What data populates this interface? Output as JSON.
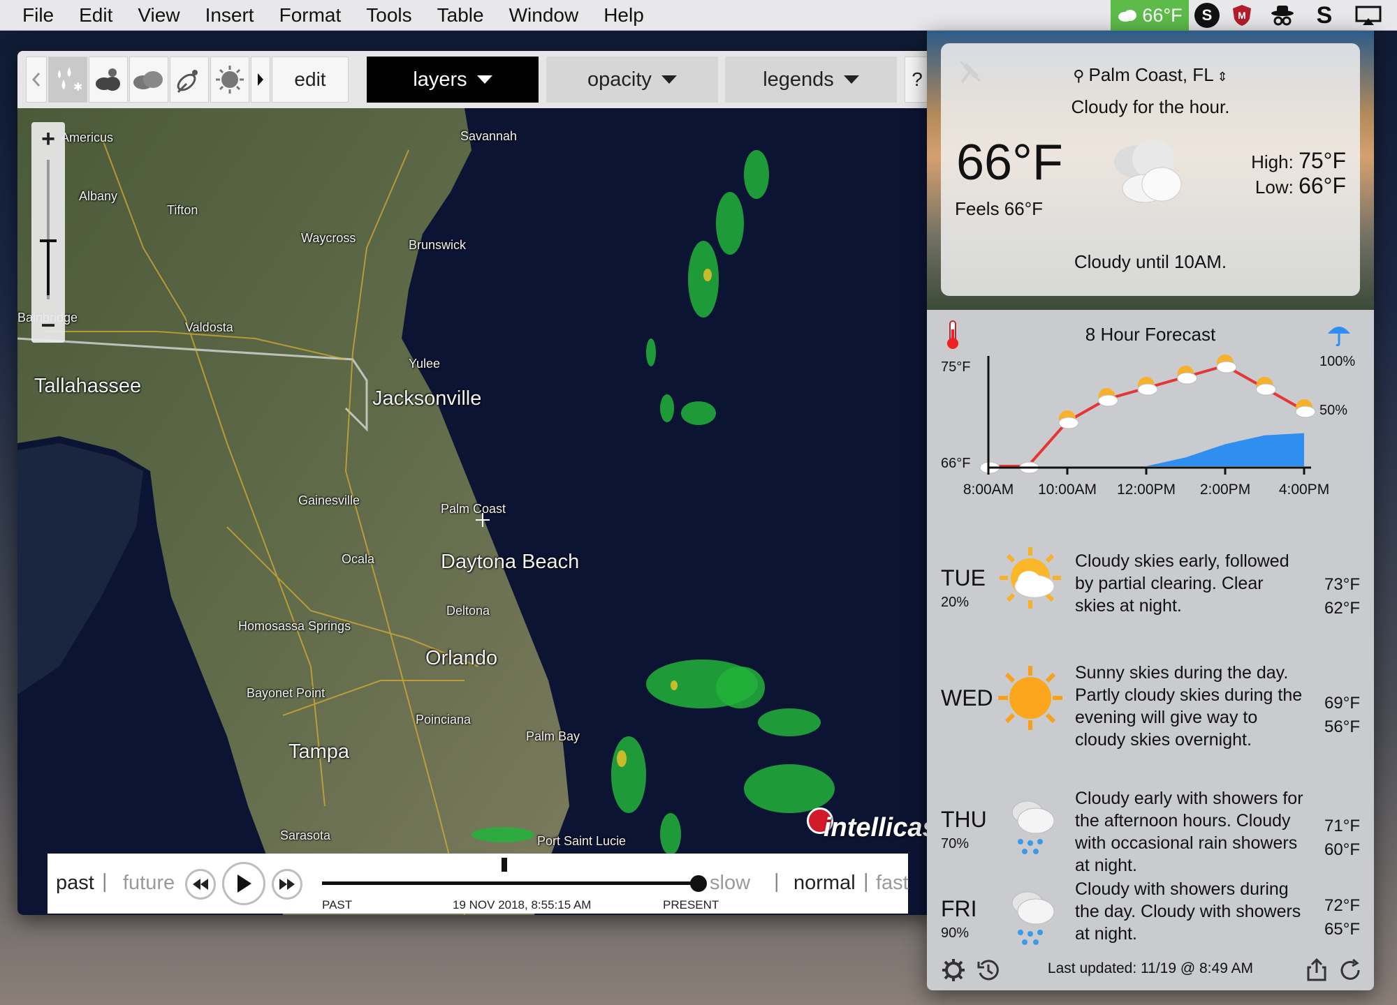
{
  "menubar": {
    "items": [
      "File",
      "Edit",
      "View",
      "Insert",
      "Format",
      "Tools",
      "Table",
      "Window",
      "Help"
    ],
    "tray_temp": "66°F",
    "tray_s_label": "S"
  },
  "toolbar": {
    "edit_label": "edit",
    "layers_label": "layers",
    "opacity_label": "opacity",
    "legends_label": "legends",
    "help_label": "?"
  },
  "map": {
    "places": [
      {
        "name": "Americus"
      },
      {
        "name": "Savannah"
      },
      {
        "name": "Albany"
      },
      {
        "name": "Tifton"
      },
      {
        "name": "Waycross"
      },
      {
        "name": "Brunswick"
      },
      {
        "name": "Bainbridge"
      },
      {
        "name": "Valdosta"
      },
      {
        "name": "Yulee"
      },
      {
        "name": "Tallahassee"
      },
      {
        "name": "Jacksonville"
      },
      {
        "name": "Gainesville"
      },
      {
        "name": "Palm Coast"
      },
      {
        "name": "Ocala"
      },
      {
        "name": "Daytona Beach"
      },
      {
        "name": "Deltona"
      },
      {
        "name": "Homosassa Springs"
      },
      {
        "name": "Orlando"
      },
      {
        "name": "Bayonet Point"
      },
      {
        "name": "Poinciana"
      },
      {
        "name": "Palm Bay"
      },
      {
        "name": "Tampa"
      },
      {
        "name": "Sarasota"
      },
      {
        "name": "Port Saint Lucie"
      }
    ],
    "logo_text": "intellicast",
    "zoom_in": "+",
    "zoom_out": "−"
  },
  "playback": {
    "past": "past",
    "future": "future",
    "slow": "slow",
    "normal": "normal",
    "fast": "fast",
    "sep": "|",
    "past_caption": "PAST",
    "timestamp": "19 NOV 2018, 8:55:15 AM",
    "present_caption": "PRESENT"
  },
  "current": {
    "location": "Palm Coast, FL",
    "summary_hour": "Cloudy for the hour.",
    "temp": "66°F",
    "feels": "Feels 66°F",
    "high_label": "High:",
    "high": "75°F",
    "low_label": "Low:",
    "low": "66°F",
    "summary_until": "Cloudy until 10AM."
  },
  "forecast_8h": {
    "title": "8 Hour Forecast",
    "temp_max_label": "75°F",
    "temp_min_label": "66°F",
    "pct_100": "100%",
    "pct_50": "50%",
    "x_labels": [
      "8:00AM",
      "10:00AM",
      "12:00PM",
      "2:00PM",
      "4:00PM"
    ]
  },
  "chart_data": {
    "type": "line",
    "title": "8 Hour Forecast",
    "x": [
      "8:00AM",
      "9:00AM",
      "10:00AM",
      "11:00AM",
      "12:00PM",
      "1:00PM",
      "2:00PM",
      "3:00PM",
      "4:00PM"
    ],
    "series": [
      {
        "values": [
          66,
          66,
          70,
          72,
          73,
          74,
          75,
          73,
          71
        ]
      },
      {
        "values": [
          0,
          0,
          0,
          0,
          0,
          8,
          20,
          28,
          30
        ]
      }
    ],
    "ylim": [
      66,
      75
    ],
    "y2lim": [
      0,
      100
    ],
    "colors": [
      "#e53535",
      "#2f8ff0"
    ]
  },
  "daily": [
    {
      "day": "TUE",
      "pop": "20%",
      "desc": "Cloudy skies early, followed by partial clearing. Clear skies at night.",
      "hi": "73°F",
      "lo": "62°F",
      "icon": "partly-cloudy-icon"
    },
    {
      "day": "WED",
      "pop": "",
      "desc": "Sunny skies during the day. Partly cloudy skies during the evening will give way to cloudy skies overnight.",
      "hi": "69°F",
      "lo": "56°F",
      "icon": "sun-icon"
    },
    {
      "day": "THU",
      "pop": "70%",
      "desc": "Cloudy early with showers for the afternoon hours. Cloudy with occasional rain showers at night.",
      "hi": "71°F",
      "lo": "60°F",
      "icon": "rain-cloud-icon"
    },
    {
      "day": "FRI",
      "pop": "90%",
      "desc": "Cloudy with showers during the day. Cloudy with showers at night.",
      "hi": "72°F",
      "lo": "65°F",
      "icon": "rain-cloud-icon"
    }
  ],
  "footer": {
    "last_updated": "Last updated: 11/19 @ 8:49 AM"
  }
}
